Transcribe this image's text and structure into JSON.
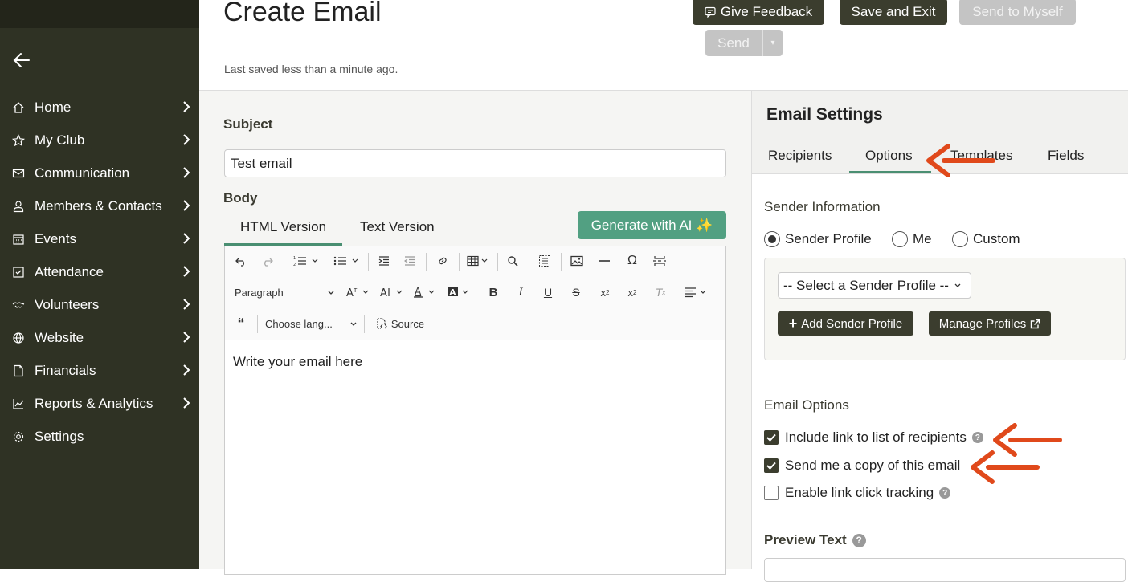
{
  "header": {
    "title": "Create Email",
    "last_saved": "Last saved less than a minute ago.",
    "feedback_label": "Give Feedback",
    "save_exit_label": "Save and Exit",
    "send_self_label": "Send to Myself",
    "send_label": "Send"
  },
  "sidebar": {
    "items": [
      {
        "label": "Home",
        "icon": "home-icon"
      },
      {
        "label": "My Club",
        "icon": "star-icon"
      },
      {
        "label": "Communication",
        "icon": "envelope-icon"
      },
      {
        "label": "Members & Contacts",
        "icon": "user-icon"
      },
      {
        "label": "Events",
        "icon": "calendar-icon"
      },
      {
        "label": "Attendance",
        "icon": "check-square-icon"
      },
      {
        "label": "Volunteers",
        "icon": "handshake-icon"
      },
      {
        "label": "Website",
        "icon": "globe-icon"
      },
      {
        "label": "Financials",
        "icon": "document-icon"
      },
      {
        "label": "Reports & Analytics",
        "icon": "chart-icon"
      },
      {
        "label": "Settings",
        "icon": "gear-icon"
      }
    ]
  },
  "main": {
    "subject_label": "Subject",
    "subject_value": "Test email",
    "body_label": "Body",
    "tabs": [
      "HTML Version",
      "Text Version"
    ],
    "generate_ai_label": "Generate with AI ✨",
    "toolbar": {
      "paragraph": "Paragraph",
      "language": "Choose lang...",
      "source": "Source"
    },
    "editor_placeholder": "Write your email here"
  },
  "settings": {
    "title": "Email Settings",
    "tabs": [
      "Recipients",
      "Options",
      "Templates",
      "Fields"
    ],
    "sender_info_label": "Sender Information",
    "radios": [
      "Sender Profile",
      "Me",
      "Custom"
    ],
    "selected_radio": "Sender Profile",
    "sender_select": "-- Select a Sender Profile --",
    "add_profile_label": "Add Sender Profile",
    "manage_profiles_label": "Manage Profiles",
    "email_options_label": "Email Options",
    "options": [
      {
        "label": "Include link to list of recipients",
        "checked": true,
        "help": true
      },
      {
        "label": "Send me a copy of this email",
        "checked": true,
        "help": false
      },
      {
        "label": "Enable link click tracking",
        "checked": false,
        "help": true
      }
    ],
    "preview_text_label": "Preview Text"
  },
  "colors": {
    "sidebar": "#2f3224",
    "accent_green": "#52a082",
    "dark_button": "#3b3d2e",
    "annotation_arrow": "#e0491b"
  }
}
